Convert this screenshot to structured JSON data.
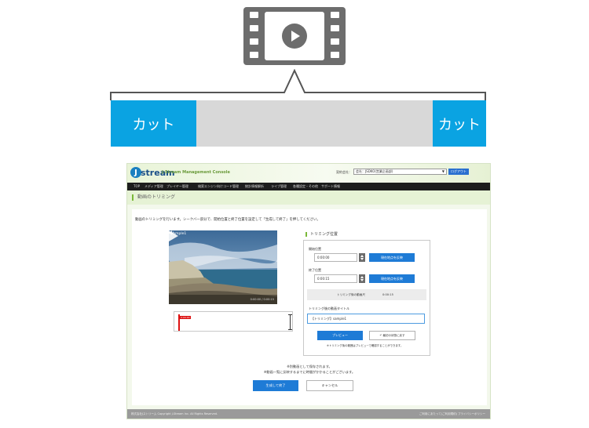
{
  "illustration": {
    "clip_bar": {
      "left_label": "カット",
      "right_label": "カット"
    },
    "colors": {
      "cut": "#0aa3e2",
      "bar": "#d8d8d8",
      "icon": "#6d6d6d"
    },
    "icon": "film-play-icon"
  },
  "console": {
    "logo": {
      "mark": "J",
      "text": "stream",
      "subtitle": "J-Stream Management Console"
    },
    "account": {
      "label": "契約会社：",
      "selected": "会社：JSDKO(営業企画部)"
    },
    "logout_label": "ログアウト",
    "nav": [
      "TOP",
      "メディア管理",
      "プレイヤー管理",
      "検索エンジン向けコード管理",
      "統計情報解析",
      "ライブ管理",
      "各種設定・その他",
      "サポート情報"
    ],
    "page_title": "動画のトリミング",
    "intro": "動画のトリミングを行います。シークバー部分で、開始位置と終了位置を設定して「生成して終了」を押してください。",
    "video": {
      "title": "sample1",
      "time": "0:00:00 / 0:00:15"
    },
    "timeline": {
      "start_marker": "0:00:00"
    },
    "trim": {
      "section_title": "トリミング位置",
      "start_label": "開始位置",
      "start_value": "0:00:00",
      "set_current_label": "現在地点を反映",
      "end_label": "終了位置",
      "end_value": "0:00:15",
      "duration_label": "トリミング後の動画尺",
      "duration_value": "0:00:15",
      "title_label": "トリミング後の動画タイトル",
      "title_value": "【トリミング】sample1",
      "preview_label": "プレビュー",
      "reset_label": "最初の状態に戻す",
      "note": "※トリミング後の範囲はプレビューで確認することができます。"
    },
    "save_note_1": "※別動画として保存されます。",
    "save_note_2": "※動画一覧に反映するまでに時間がかかることがございます。",
    "done_label": "生成して終了",
    "cancel_label": "キャンセル",
    "footer_left": "株式会社Jストリーム  Copyright J-Stream Inc. All Rights Reserved.",
    "footer_right": "ご利用にあたって(ご利用規約)  プライバシーポリシー"
  }
}
